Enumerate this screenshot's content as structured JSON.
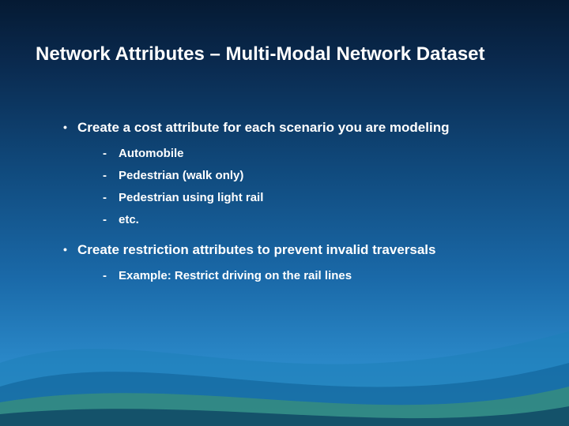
{
  "title": "Network Attributes – Multi-Modal Network Dataset",
  "points": [
    {
      "text": "Create a cost attribute for each scenario you are modeling",
      "sub": [
        "Automobile",
        "Pedestrian (walk only)",
        "Pedestrian using light rail",
        "etc."
      ]
    },
    {
      "text": "Create restriction attributes to prevent invalid traversals",
      "sub": [
        "Example: Restrict driving on the rail lines"
      ]
    }
  ]
}
